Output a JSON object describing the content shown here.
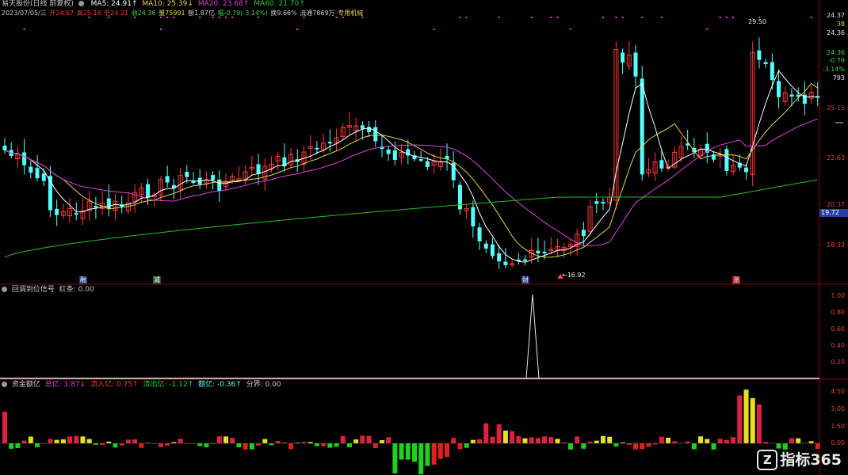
{
  "header": {
    "stock_name": "易天股份(日线 前复权)",
    "ma5": "MA5: 24.91↑",
    "ma10": "MA10: 25.39↓",
    "ma20": "MA20: 23.68↑",
    "ma60": "MA60: 21.70↑",
    "date": "2023/07/05/三",
    "open": "开24.67",
    "high": "高25.16",
    "low": "低24.21",
    "close": "收24.36",
    "volume": "量75991",
    "amount": "额1.87亿",
    "change": "幅-0.79(-3.14%)",
    "turnover": "换9.66%",
    "float_shares": "流通7869万",
    "sector": "专用机械"
  },
  "price_axis": {
    "ticks": [
      "25.15",
      "22.63",
      "20.37",
      "18.33"
    ],
    "info": [
      "24.37",
      "38",
      "24.36",
      "24.36",
      "-0.79",
      "-3.14%",
      "793"
    ],
    "cursor_price": "19.72"
  },
  "annotations": {
    "high_label": "29.50",
    "low_label": "←16.92",
    "events": [
      "融",
      "减",
      "财",
      "涨"
    ]
  },
  "indicator1": {
    "title": "回调到位信号",
    "value": "红条: 0.00",
    "ticks": [
      "1.00",
      "0.80",
      "0.60",
      "0.40",
      "0.20"
    ]
  },
  "indicator2": {
    "title": "资金额亿",
    "total": "总亿: 1.87↓",
    "inflow": "流入亿: 0.75↑",
    "outflow": "流出亿: -1.12↑",
    "net": "额亿: -0.36↑",
    "divider": "分界: 0.00",
    "ticks": [
      "4.50",
      "3.00",
      "1.50",
      "0.00"
    ]
  },
  "colors": {
    "up": "#ff3838",
    "down": "#54ffff",
    "ma5": "#ffffff",
    "ma10": "#e8d44a",
    "ma20": "#e040e0",
    "ma60": "#20c020",
    "grid": "#8b0000"
  },
  "logo": {
    "icon": "Z",
    "text": "指标365"
  }
}
